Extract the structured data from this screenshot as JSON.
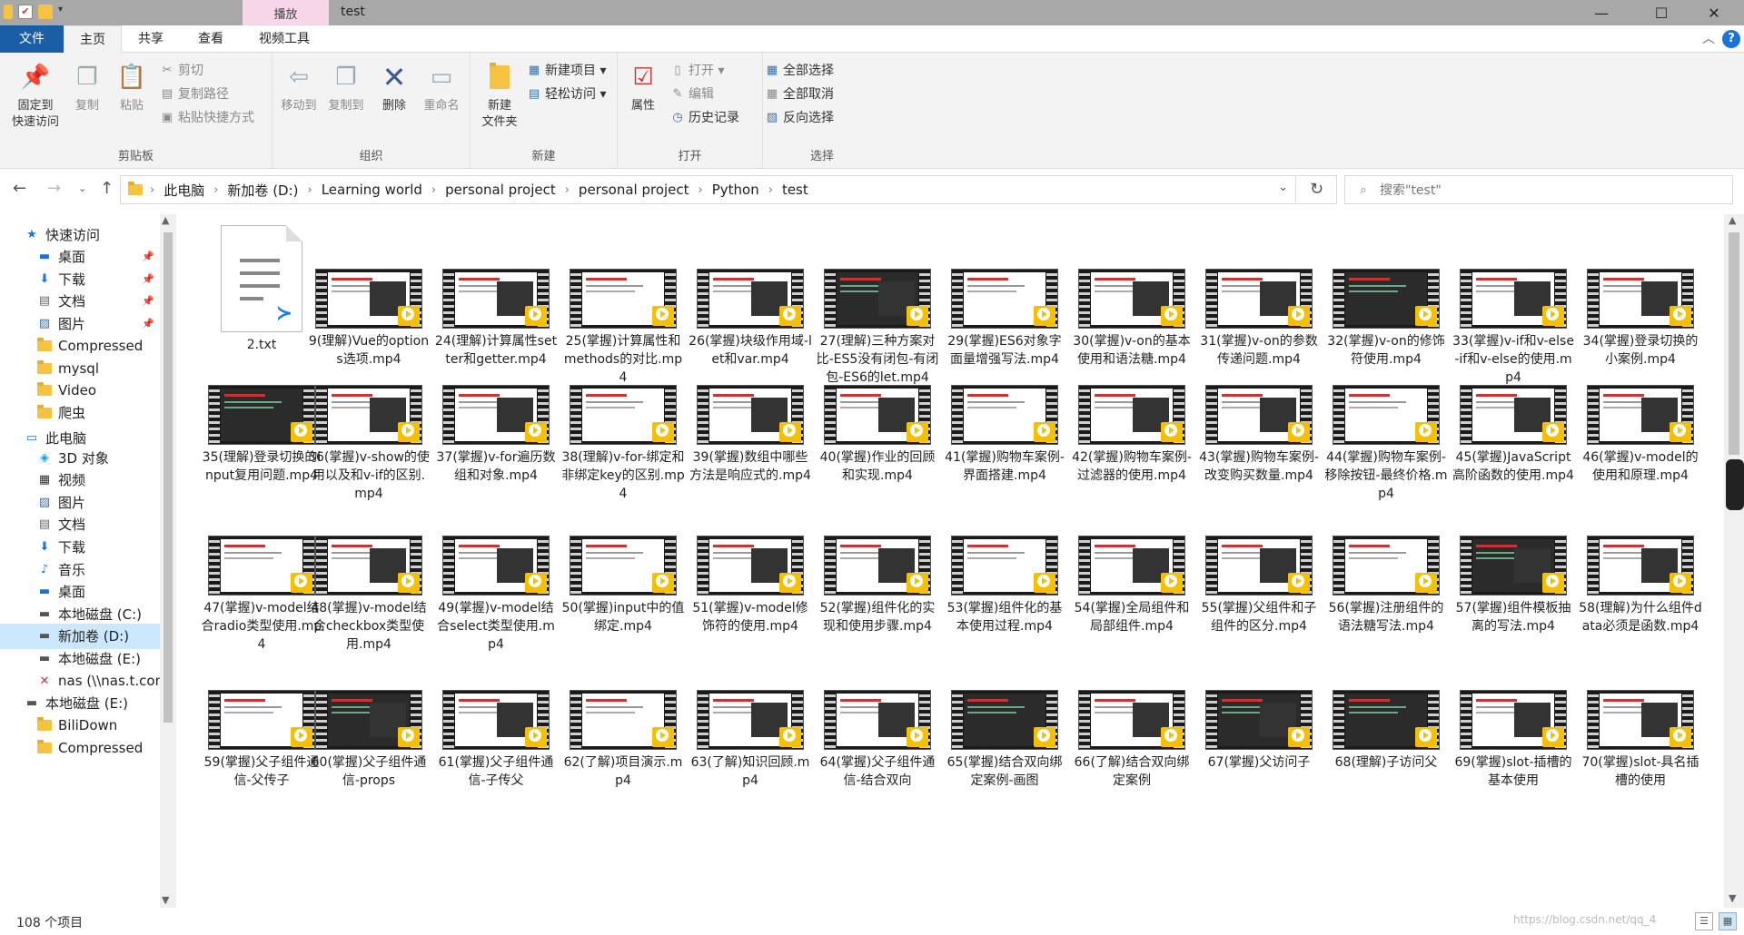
{
  "window": {
    "title": "test",
    "context_tab": "播放",
    "controls": {
      "minimize": "—",
      "maximize": "☐",
      "close": "✕"
    }
  },
  "ribbon_tabs": [
    "文件",
    "主页",
    "共享",
    "查看",
    "视频工具"
  ],
  "ribbon": {
    "clipboard": {
      "label": "剪贴板",
      "pin": "固定到\n快速访问",
      "copy": "复制",
      "paste": "粘贴",
      "cut": "剪切",
      "copy_path": "复制路径",
      "paste_shortcut": "粘贴快捷方式"
    },
    "organize": {
      "label": "组织",
      "move_to": "移动到",
      "copy_to": "复制到",
      "delete": "删除",
      "rename": "重命名"
    },
    "new": {
      "label": "新建",
      "new_folder": "新建\n文件夹",
      "new_item": "新建项目 ▾",
      "easy_access": "轻松访问 ▾"
    },
    "open": {
      "label": "打开",
      "properties": "属性",
      "open": "打开 ▾",
      "edit": "编辑",
      "history": "历史记录"
    },
    "select": {
      "label": "选择",
      "select_all": "全部选择",
      "select_none": "全部取消",
      "invert": "反向选择"
    }
  },
  "address": {
    "breadcrumbs": [
      "此电脑",
      "新加卷 (D:)",
      "Learning world",
      "personal project",
      "personal project",
      "Python",
      "test"
    ],
    "search_placeholder": "搜索\"test\""
  },
  "nav": [
    {
      "label": "快速访问",
      "icon": "star-icon",
      "indent": 0,
      "pinned": false
    },
    {
      "label": "桌面",
      "icon": "desktop-icon",
      "indent": 1,
      "pinned": true
    },
    {
      "label": "下载",
      "icon": "download-icon",
      "indent": 1,
      "pinned": true
    },
    {
      "label": "文档",
      "icon": "document-icon",
      "indent": 1,
      "pinned": true
    },
    {
      "label": "图片",
      "icon": "picture-icon",
      "indent": 1,
      "pinned": true
    },
    {
      "label": "Compressed",
      "icon": "folder-icon",
      "indent": 1,
      "pinned": false
    },
    {
      "label": "mysql",
      "icon": "folder-icon",
      "indent": 1,
      "pinned": false
    },
    {
      "label": "Video",
      "icon": "folder-icon",
      "indent": 1,
      "pinned": false
    },
    {
      "label": "爬虫",
      "icon": "folder-icon",
      "indent": 1,
      "pinned": false
    },
    {
      "label": "此电脑",
      "icon": "computer-icon",
      "indent": 0,
      "pinned": false
    },
    {
      "label": "3D 对象",
      "icon": "3d-objects-icon",
      "indent": 1,
      "pinned": false
    },
    {
      "label": "视频",
      "icon": "video-icon",
      "indent": 1,
      "pinned": false
    },
    {
      "label": "图片",
      "icon": "picture-icon",
      "indent": 1,
      "pinned": false
    },
    {
      "label": "文档",
      "icon": "document-icon",
      "indent": 1,
      "pinned": false
    },
    {
      "label": "下载",
      "icon": "download-icon",
      "indent": 1,
      "pinned": false
    },
    {
      "label": "音乐",
      "icon": "music-icon",
      "indent": 1,
      "pinned": false
    },
    {
      "label": "桌面",
      "icon": "desktop-icon",
      "indent": 1,
      "pinned": false
    },
    {
      "label": "本地磁盘 (C:)",
      "icon": "drive-icon",
      "indent": 1,
      "pinned": false
    },
    {
      "label": "新加卷 (D:)",
      "icon": "drive-icon",
      "indent": 1,
      "pinned": false,
      "selected": true
    },
    {
      "label": "本地磁盘 (E:)",
      "icon": "drive-icon",
      "indent": 1,
      "pinned": false
    },
    {
      "label": "nas (\\\\nas.t.con",
      "icon": "network-drive-icon",
      "indent": 1,
      "pinned": false
    },
    {
      "label": "本地磁盘 (E:)",
      "icon": "drive-icon",
      "indent": 0,
      "pinned": false
    },
    {
      "label": "BiliDown",
      "icon": "folder-icon",
      "indent": 1,
      "pinned": false
    },
    {
      "label": "Compressed",
      "icon": "folder-icon",
      "indent": 1,
      "pinned": false
    }
  ],
  "files": [
    {
      "name": "2.txt",
      "type": "txt"
    },
    {
      "name": "9(理解)Vue的options选项.mp4",
      "type": "mp4"
    },
    {
      "name": "24(理解)计算属性setter和getter.mp4",
      "type": "mp4"
    },
    {
      "name": "25(掌握)计算属性和methods的对比.mp4",
      "type": "mp4"
    },
    {
      "name": "26(掌握)块级作用域-let和var.mp4",
      "type": "mp4"
    },
    {
      "name": "27(理解)三种方案对比-ES5没有闭包-有闭包-ES6的let.mp4",
      "type": "mp4",
      "dark": true
    },
    {
      "name": "29(掌握)ES6对象字面量增强写法.mp4",
      "type": "mp4"
    },
    {
      "name": "30(掌握)v-on的基本使用和语法糖.mp4",
      "type": "mp4"
    },
    {
      "name": "31(掌握)v-on的参数传递问题.mp4",
      "type": "mp4"
    },
    {
      "name": "32(掌握)v-on的修饰符使用.mp4",
      "type": "mp4",
      "dark": true
    },
    {
      "name": "33(掌握)v-if和v-else-if和v-else的使用.mp4",
      "type": "mp4"
    },
    {
      "name": "34(掌握)登录切换的小案例.mp4",
      "type": "mp4"
    },
    {
      "name": "35(理解)登录切换的input复用问题.mp4",
      "type": "mp4",
      "dark": true
    },
    {
      "name": "36(掌握)v-show的使用以及和v-if的区别.mp4",
      "type": "mp4"
    },
    {
      "name": "37(掌握)v-for遍历数组和对象.mp4",
      "type": "mp4"
    },
    {
      "name": "38(理解)v-for-绑定和非绑定key的区别.mp4",
      "type": "mp4"
    },
    {
      "name": "39(掌握)数组中哪些方法是响应式的.mp4",
      "type": "mp4"
    },
    {
      "name": "40(掌握)作业的回顾和实现.mp4",
      "type": "mp4"
    },
    {
      "name": "41(掌握)购物车案例-界面搭建.mp4",
      "type": "mp4"
    },
    {
      "name": "42(掌握)购物车案例-过滤器的使用.mp4",
      "type": "mp4"
    },
    {
      "name": "43(掌握)购物车案例-改变购买数量.mp4",
      "type": "mp4"
    },
    {
      "name": "44(掌握)购物车案例-移除按钮-最终价格.mp4",
      "type": "mp4"
    },
    {
      "name": "45(掌握)JavaScript高阶函数的使用.mp4",
      "type": "mp4"
    },
    {
      "name": "46(掌握)v-model的使用和原理.mp4",
      "type": "mp4"
    },
    {
      "name": "47(掌握)v-model结合radio类型使用.mp4",
      "type": "mp4"
    },
    {
      "name": "48(掌握)v-model结合checkbox类型使用.mp4",
      "type": "mp4"
    },
    {
      "name": "49(掌握)v-model结合select类型使用.mp4",
      "type": "mp4"
    },
    {
      "name": "50(掌握)input中的值绑定.mp4",
      "type": "mp4"
    },
    {
      "name": "51(掌握)v-model修饰符的使用.mp4",
      "type": "mp4"
    },
    {
      "name": "52(掌握)组件化的实现和使用步骤.mp4",
      "type": "mp4"
    },
    {
      "name": "53(掌握)组件化的基本使用过程.mp4",
      "type": "mp4"
    },
    {
      "name": "54(掌握)全局组件和局部组件.mp4",
      "type": "mp4"
    },
    {
      "name": "55(掌握)父组件和子组件的区分.mp4",
      "type": "mp4"
    },
    {
      "name": "56(掌握)注册组件的语法糖写法.mp4",
      "type": "mp4"
    },
    {
      "name": "57(掌握)组件模板抽离的写法.mp4",
      "type": "mp4",
      "dark": true
    },
    {
      "name": "58(理解)为什么组件data必须是函数.mp4",
      "type": "mp4"
    },
    {
      "name": "59(掌握)父子组件通信-父传子",
      "type": "mp4"
    },
    {
      "name": "60(掌握)父子组件通信-props",
      "type": "mp4",
      "dark": true
    },
    {
      "name": "61(掌握)父子组件通信-子传父",
      "type": "mp4"
    },
    {
      "name": "62(了解)项目演示.mp4",
      "type": "mp4"
    },
    {
      "name": "63(了解)知识回顾.mp4",
      "type": "mp4"
    },
    {
      "name": "64(掌握)父子组件通信-结合双向",
      "type": "mp4"
    },
    {
      "name": "65(掌握)结合双向绑定案例-画图",
      "type": "mp4",
      "dark": true
    },
    {
      "name": "66(了解)结合双向绑定案例",
      "type": "mp4"
    },
    {
      "name": "67(掌握)父访问子",
      "type": "mp4",
      "dark": true
    },
    {
      "name": "68(理解)子访问父",
      "type": "mp4",
      "dark": true
    },
    {
      "name": "69(掌握)slot-插槽的基本使用",
      "type": "mp4"
    },
    {
      "name": "70(掌握)slot-具名插槽的使用",
      "type": "mp4"
    }
  ],
  "status": {
    "count": "108 个项目",
    "watermark": "https://blog.csdn.net/qq_4"
  }
}
